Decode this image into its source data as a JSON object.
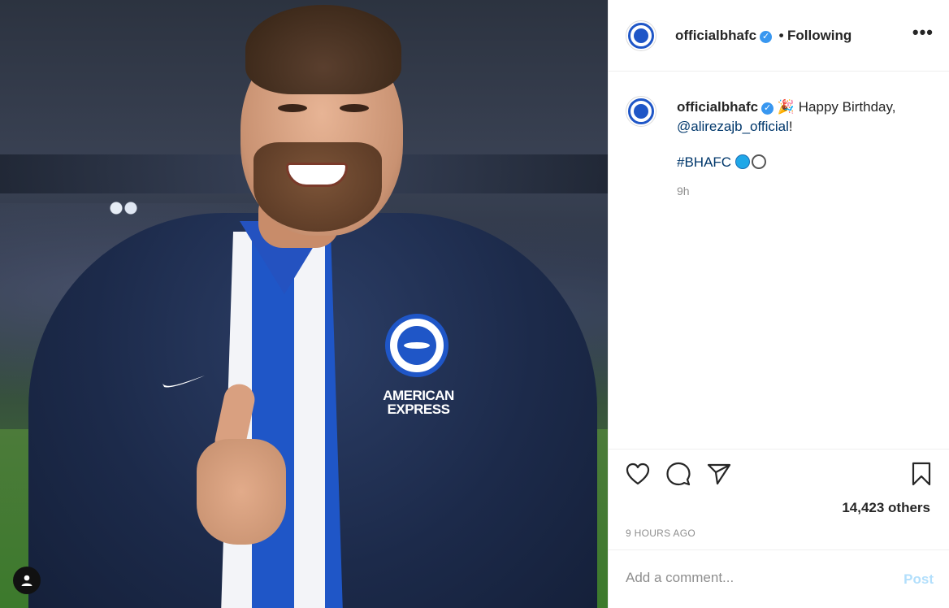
{
  "post": {
    "image_alt": "Player in Brighton jacket smiling with thumbs up",
    "sponsor_line1": "AMERICAN",
    "sponsor_line2": "EXPRESS"
  },
  "header": {
    "username": "officialbhafc",
    "separator": "•",
    "follow_status": "Following",
    "more_label": "•••",
    "verified_glyph": "✓"
  },
  "caption": {
    "username": "officialbhafc",
    "emoji": "🎉",
    "text_part1": "Happy Birthday,",
    "mention": "@alirezajb_official",
    "text_part2": "!",
    "hashtag": "#BHAFC",
    "time_ago": "9h"
  },
  "actions": {
    "likes_text": "14,423 others",
    "post_time": "9 HOURS AGO"
  },
  "comment": {
    "placeholder": "Add a comment...",
    "post_label": "Post"
  },
  "colors": {
    "brand_blue": "#1f56c7",
    "verified_blue": "#3897f0",
    "post_disabled": "#b2dffc"
  }
}
